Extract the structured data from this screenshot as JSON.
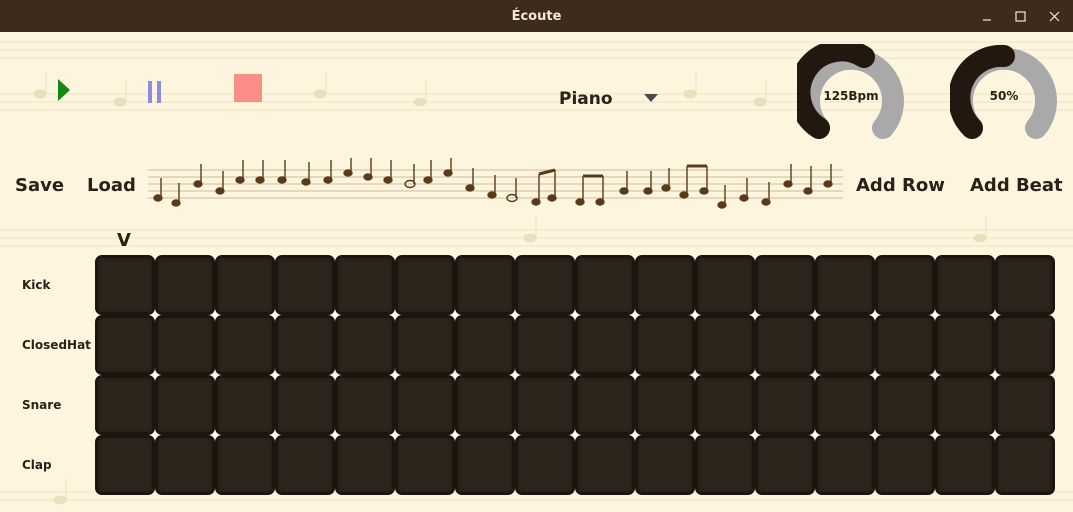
{
  "window": {
    "title": "Écoute",
    "controls": {
      "minimize": "minimize-icon",
      "maximize": "maximize-icon",
      "close": "close-icon"
    }
  },
  "transport": {
    "play": {
      "icon": "play-icon",
      "color": "#118a11"
    },
    "pause": {
      "icon": "pause-icon",
      "color": "#8c8ce8"
    },
    "stop": {
      "icon": "stop-icon",
      "color": "#fb8e86"
    }
  },
  "instrument": {
    "selected": "Piano",
    "icon": "caret-down-icon"
  },
  "tempo": {
    "label": "125Bpm",
    "value": 125,
    "fill_fraction": 0.6
  },
  "volume": {
    "label": "50%",
    "value": 50,
    "fill_fraction": 0.5
  },
  "toolbar": {
    "save_label": "Save",
    "load_label": "Load",
    "add_row_label": "Add Row",
    "add_beat_label": "Add Beat"
  },
  "playhead": {
    "label": "V",
    "beat_index": 0
  },
  "sequencer": {
    "beats": 16,
    "rows": [
      {
        "label": "Kick",
        "steps": [
          false,
          false,
          false,
          false,
          false,
          false,
          false,
          false,
          false,
          false,
          false,
          false,
          false,
          false,
          false,
          false
        ]
      },
      {
        "label": "ClosedHat",
        "steps": [
          false,
          false,
          false,
          false,
          false,
          false,
          false,
          false,
          false,
          false,
          false,
          false,
          false,
          false,
          false,
          false
        ]
      },
      {
        "label": "Snare",
        "steps": [
          false,
          false,
          false,
          false,
          false,
          false,
          false,
          false,
          false,
          false,
          false,
          false,
          false,
          false,
          false,
          false
        ]
      },
      {
        "label": "Clap",
        "steps": [
          false,
          false,
          false,
          false,
          false,
          false,
          false,
          false,
          false,
          false,
          false,
          false,
          false,
          false,
          false,
          false
        ]
      }
    ],
    "cell_color": "#2a2119"
  },
  "colors": {
    "titlebar": "#3d2b1d",
    "background": "#fdf5de",
    "gauge_filled": "#231810",
    "gauge_track": "#a9a9a9"
  }
}
